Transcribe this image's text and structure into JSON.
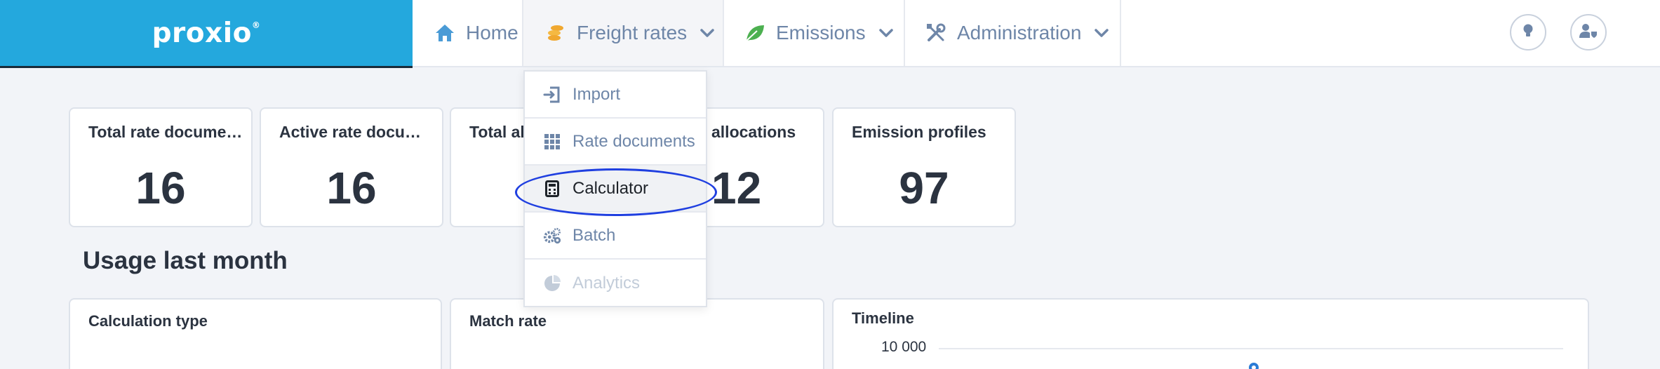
{
  "brand": {
    "name": "proxio",
    "mark": "®"
  },
  "nav": {
    "home": "Home",
    "freight": "Freight rates",
    "emissions": "Emissions",
    "administration": "Administration"
  },
  "dropdown": {
    "items": [
      {
        "label": "Import",
        "icon": "import-icon"
      },
      {
        "label": "Rate documents",
        "icon": "grid-icon"
      },
      {
        "label": "Calculator",
        "icon": "calculator-icon",
        "active": true
      },
      {
        "label": "Batch",
        "icon": "gears-icon"
      },
      {
        "label": "Analytics",
        "icon": "pie-chart-icon",
        "disabled": true
      }
    ]
  },
  "stats": [
    {
      "label": "Total rate docume…",
      "value": "16"
    },
    {
      "label": "Active rate docum…",
      "value": "16"
    },
    {
      "label": "Total all",
      "value": ""
    },
    {
      "label": "allocations",
      "value": "12"
    },
    {
      "label": "Emission profiles",
      "value": "97"
    }
  ],
  "usage": {
    "title": "Usage last month",
    "panels": {
      "calculation_type": "Calculation type",
      "match_rate": "Match rate",
      "timeline": "Timeline"
    },
    "timeline_tick": "10 000"
  },
  "colors": {
    "brand": "#24a8dd",
    "nav_text": "#6e86a8",
    "highlight": "#1f3fe0",
    "freight_icon": "#f0a830",
    "emissions_icon": "#4cb050"
  }
}
